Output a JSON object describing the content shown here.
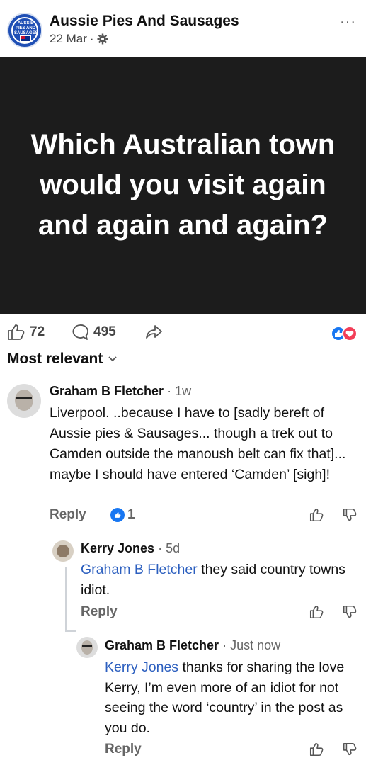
{
  "page": {
    "name": "Aussie Pies And Sausages",
    "date": "22 Mar",
    "separator": "·",
    "avatar_text": "AUSSIE PIES AND SAUSAGES",
    "more_label": "···"
  },
  "post": {
    "headline": "Which Australian town would you visit again and again and again?"
  },
  "actions": {
    "likes": "72",
    "comments": "495"
  },
  "sort": {
    "label": "Most relevant"
  },
  "comments": [
    {
      "author": "Graham B Fletcher",
      "time": "· 1w",
      "text": "Liverpool. ..because I have to  [sadly bereft of Aussie pies & Sausages... though a trek out to Camden outside the manoush belt can fix that]... maybe I should have entered ‘Camden’ [sigh]!",
      "reply_label": "Reply",
      "reaction_count": "1"
    },
    {
      "author": "Kerry Jones",
      "time": "· 5d",
      "mention": "Graham B Fletcher",
      "text": " they said country towns idiot.",
      "reply_label": "Reply"
    },
    {
      "author": "Graham B Fletcher",
      "time": "· Just now",
      "mention": "Kerry Jones",
      "text": " thanks for sharing the love Kerry, I’m even more of an idiot for not seeing the word ‘country’ in the post as you do.",
      "reply_label": "Reply"
    }
  ],
  "colors": {
    "accent": "#1877f2",
    "mention": "#2c5fbf",
    "image_bg": "#1c1c1c"
  }
}
